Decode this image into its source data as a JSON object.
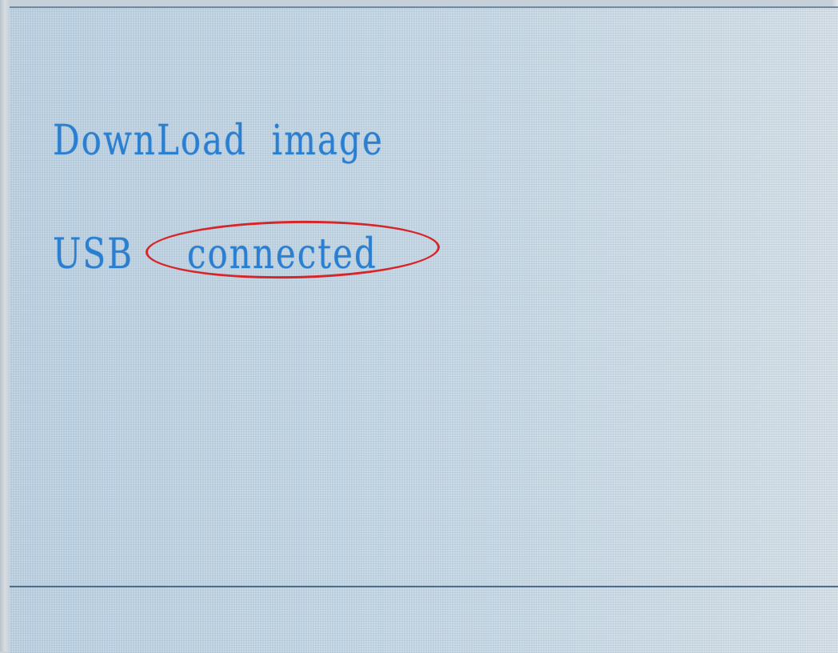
{
  "screen": {
    "title": "DownLoad  image",
    "usb_label": "USB",
    "usb_status": "connected"
  },
  "colors": {
    "lcd_text": "#2b7fd0",
    "highlight_ring": "#d6262a",
    "lcd_background": "#bed2e1"
  }
}
